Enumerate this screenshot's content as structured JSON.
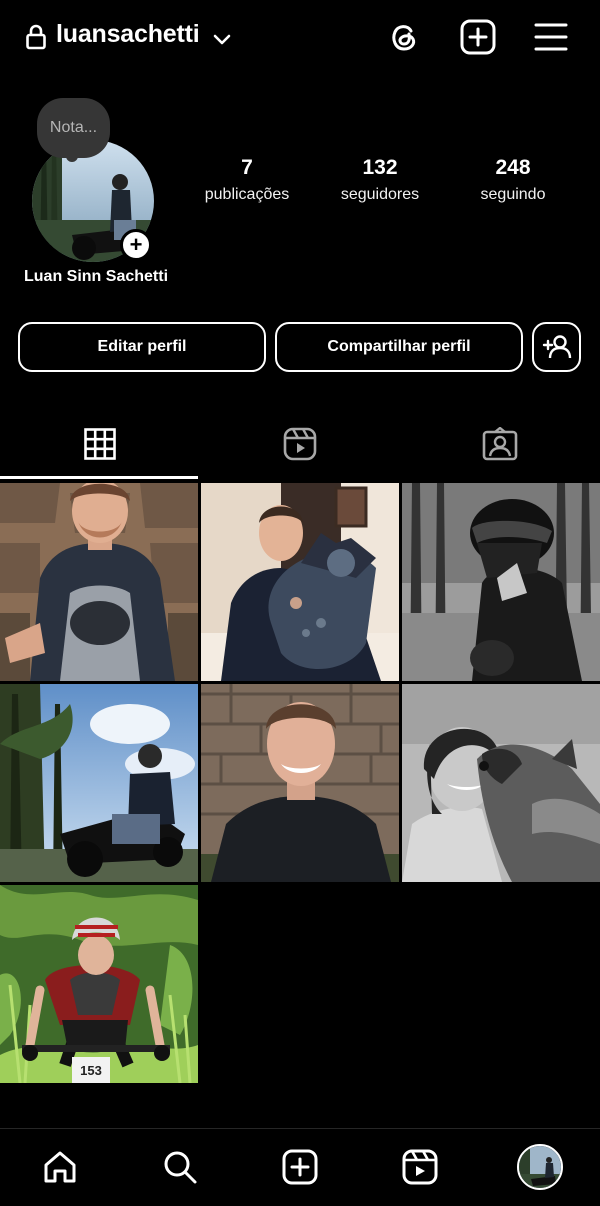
{
  "header": {
    "username": "luansachetti",
    "icons": [
      "lock-icon",
      "chevron-down-icon",
      "threads-icon",
      "create-post-icon",
      "menu-icon"
    ]
  },
  "profile": {
    "note_placeholder": "Nota...",
    "full_name": "Luan Sinn Sachetti",
    "add_story_symbol": "+",
    "stats": [
      {
        "value": "7",
        "label": "publicações"
      },
      {
        "value": "132",
        "label": "seguidores"
      },
      {
        "value": "248",
        "label": "seguindo"
      }
    ]
  },
  "actions": {
    "edit_profile": "Editar perfil",
    "share_profile": "Compartilhar perfil",
    "discover_icon": "add-person-icon"
  },
  "tabs": [
    {
      "name": "posts-grid",
      "icon": "grid-icon",
      "active": true
    },
    {
      "name": "reels",
      "icon": "reels-icon",
      "active": false
    },
    {
      "name": "tagged",
      "icon": "tagged-person-icon",
      "active": false
    }
  ],
  "posts": [
    {
      "desc": "man sitting by stone wall",
      "style": "color"
    },
    {
      "desc": "man with dog indoors",
      "style": "color"
    },
    {
      "desc": "motorcyclist with helmet in forest",
      "style": "bw"
    },
    {
      "desc": "silhouette on motorcycle under trees",
      "style": "color"
    },
    {
      "desc": "smiling man by brick wall",
      "style": "color"
    },
    {
      "desc": "man with dog",
      "style": "bw"
    },
    {
      "desc": "mountain biker in jungle",
      "style": "color"
    }
  ],
  "bottom_nav": [
    "home-icon",
    "search-icon",
    "create-icon",
    "reels-icon",
    "profile-avatar"
  ]
}
